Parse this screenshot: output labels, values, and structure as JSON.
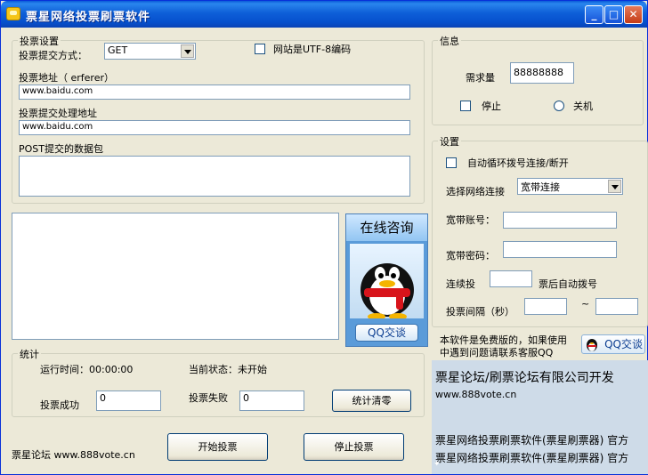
{
  "window": {
    "title": "票星网络投票刷票软件",
    "minimize": "_",
    "maximize": "□",
    "close": "✕"
  },
  "vote_settings": {
    "group_title": "投票设置",
    "method_label": "投票提交方式：",
    "method_value": "GET",
    "utf8_label": "网站是UTF-8编码",
    "url_label": "投票地址（ erferer）",
    "url_value": "www.baidu.com",
    "process_url_label": "投票提交处理地址",
    "process_url_value": "www.baidu.com",
    "post_label": "POST提交的数据包",
    "post_value": ""
  },
  "info": {
    "group_title": "信息",
    "demand_label": "需求量",
    "demand_value": "88888888",
    "stop_label": "停止",
    "shutdown_label": "关机"
  },
  "settings": {
    "group_title": "设置",
    "auto_dial_label": "自动循环拨号连接/断开",
    "network_label": "选择网络连接",
    "network_value": "宽带连接",
    "account_label": "宽带账号：",
    "account_value": "",
    "password_label": "宽带密码：",
    "password_value": "",
    "consecutive_label": "连续投",
    "consecutive_value": "",
    "after_label": "票后自动拨号",
    "interval_label": "投票间隔（秒）",
    "interval_from": "",
    "tilde": "~",
    "interval_to": ""
  },
  "consult": {
    "header": "在线咨询",
    "qq_button": "QQ交谈"
  },
  "notice": {
    "line1": "本软件是免费版的，如果使用",
    "line2": "中遇到问题请联系客服QQ",
    "qq_button": "QQ交谈"
  },
  "stats": {
    "group_title": "统计",
    "runtime_label": "运行时间：",
    "runtime_value": "00:00:00",
    "status_label": "当前状态：",
    "status_value": "未开始",
    "success_label": "投票成功",
    "success_value": "0",
    "fail_label": "投票失败",
    "fail_value": "0",
    "reset_button": "统计清零"
  },
  "footer": {
    "site_text": "票星论坛 www.888vote.cn",
    "start_button": "开始投票",
    "stop_button": "停止投票"
  },
  "banner": {
    "line1": "票星论坛/刷票论坛有限公司开发",
    "line2": "www.888vote.cn",
    "line3": "票星网络投票刷票软件(票星刷票器) 官方",
    "line4": "票星网络投票刷票软件(票星刷票器) 官方"
  },
  "icons": {
    "app": "app-icon",
    "qq_penguin": "qq-penguin-icon",
    "dropdown": "chevron-down-icon"
  }
}
